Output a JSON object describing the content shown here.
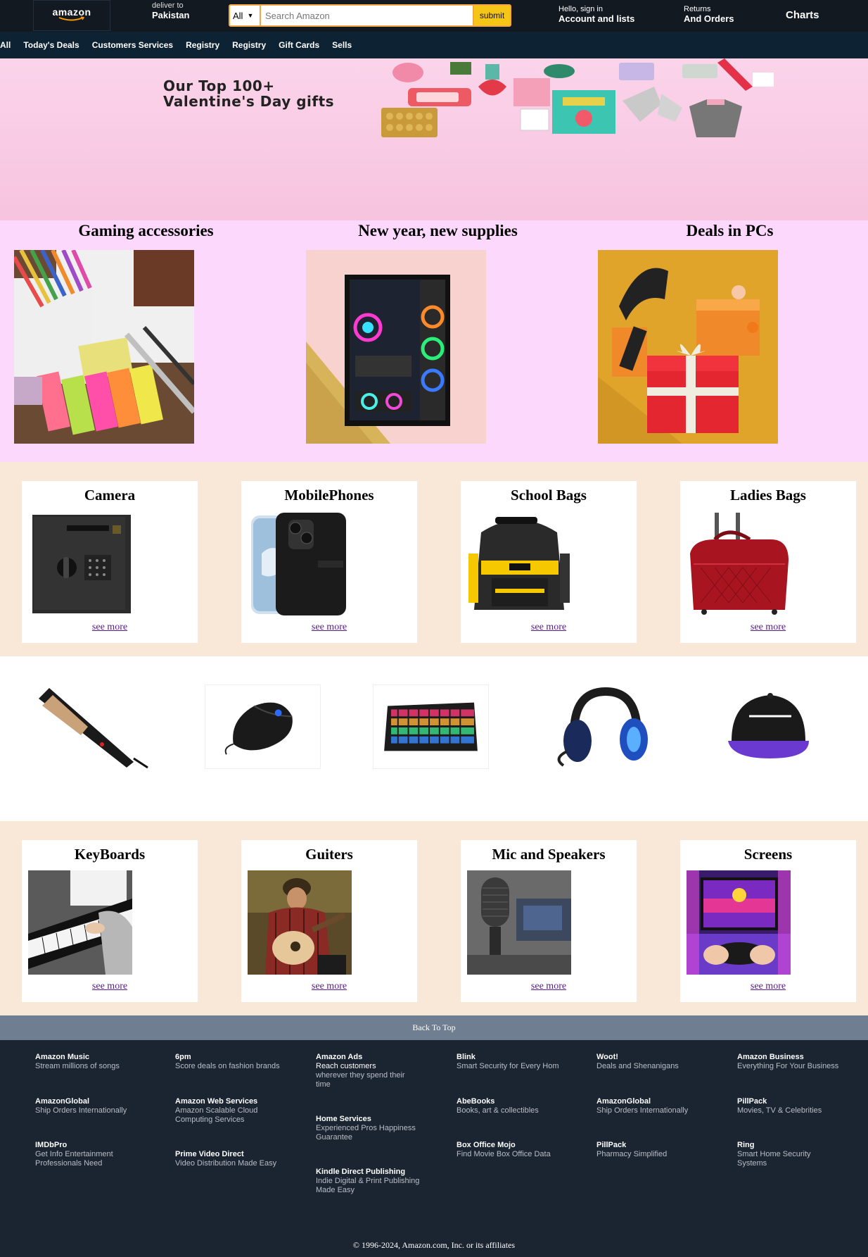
{
  "header": {
    "logo": "amazon",
    "deliver_small": "deliver to",
    "deliver_big": "Pakistan",
    "search_category": "All",
    "search_placeholder": "Search Amazon",
    "search_button": "submit",
    "account_small": "Hello, sign in",
    "account_big": "Account and lists",
    "orders_small": "Returns",
    "orders_big": "And Orders",
    "charts": "Charts"
  },
  "nav": {
    "items": [
      "All",
      "Today's Deals",
      "Customers Services",
      "Registry",
      "Registry",
      "Gift Cards",
      "Sells"
    ]
  },
  "hero": {
    "title_line1": "Our Top 100+",
    "title_line2": "Valentine's Day gifts"
  },
  "featured": [
    {
      "title": "Gaming accessories",
      "image": "stationery-photo"
    },
    {
      "title": "New year, new supplies",
      "image": "gaming-pc-photo"
    },
    {
      "title": "Deals in PCs",
      "image": "gift-box-photo"
    }
  ],
  "cards_row1": [
    {
      "title": "Camera",
      "image": "safe-photo",
      "link": "see more"
    },
    {
      "title": "MobilePhones",
      "image": "phone-case-photo",
      "link": "see more"
    },
    {
      "title": "School Bags",
      "image": "backpack-photo",
      "link": "see more"
    },
    {
      "title": "Ladies Bags",
      "image": "duffel-bag-photo",
      "link": "see more"
    }
  ],
  "products_strip": [
    "hair-straightener",
    "gaming-mouse",
    "rgb-keyboard",
    "gaming-headset",
    "snapback-cap"
  ],
  "cards_row2": [
    {
      "title": "KeyBoards",
      "image": "piano-photo",
      "link": "see more"
    },
    {
      "title": "Guiters",
      "image": "guitar-photo",
      "link": "see more"
    },
    {
      "title": "Mic and Speakers",
      "image": "microphone-photo",
      "link": "see more"
    },
    {
      "title": "Screens",
      "image": "gaming-screen-photo",
      "link": "see more"
    }
  ],
  "back_to_top": "Back To Top",
  "footer": {
    "columns": [
      [
        {
          "title": "Amazon Music",
          "desc": "Stream millions of songs"
        },
        {
          "title": "AmazonGlobal",
          "desc": "Ship Orders Internationally"
        },
        {
          "title": "IMDbPro",
          "desc": "Get Info Entertainment Professionals Need"
        }
      ],
      [
        {
          "title": "6pm",
          "desc": "Score deals on fashion brands"
        },
        {
          "title": "Amazon Web Services",
          "desc": "Amazon Scalable Cloud Computing Services"
        },
        {
          "title": "Prime Video Direct",
          "desc": "Video Distribution Made Easy"
        }
      ],
      [
        {
          "title": "Amazon Ads",
          "desc": "Reach customers",
          "desc2": "wherever they spend their time"
        },
        {
          "title": "Home Services",
          "desc": "Experienced Pros Happiness Guarantee"
        },
        {
          "title": "Kindle Direct Publishing",
          "desc": "Indie Digital & Print Publishing Made Easy"
        }
      ],
      [
        {
          "title": "Blink",
          "desc": "Smart Security for Every Hom"
        },
        {
          "title": "AbeBooks",
          "desc": "Books, art & collectibles"
        },
        {
          "title": "Box Office Mojo",
          "desc": "Find Movie Box Office Data"
        }
      ],
      [
        {
          "title": "Woot!",
          "desc": "Deals and Shenanigans"
        },
        {
          "title": "AmazonGlobal",
          "desc": "Ship Orders Internationally"
        },
        {
          "title": "PillPack",
          "desc": "Pharmacy Simplified"
        }
      ],
      [
        {
          "title": "Amazon Business",
          "desc": "Everything For Your Business"
        },
        {
          "title": "PillPack",
          "desc": "Movies, TV & Celebrities"
        },
        {
          "title": "Ring",
          "desc": "Smart Home Security Systems"
        }
      ]
    ],
    "copyright": "© 1996-2024, Amazon.com, Inc. or its affiliates"
  }
}
